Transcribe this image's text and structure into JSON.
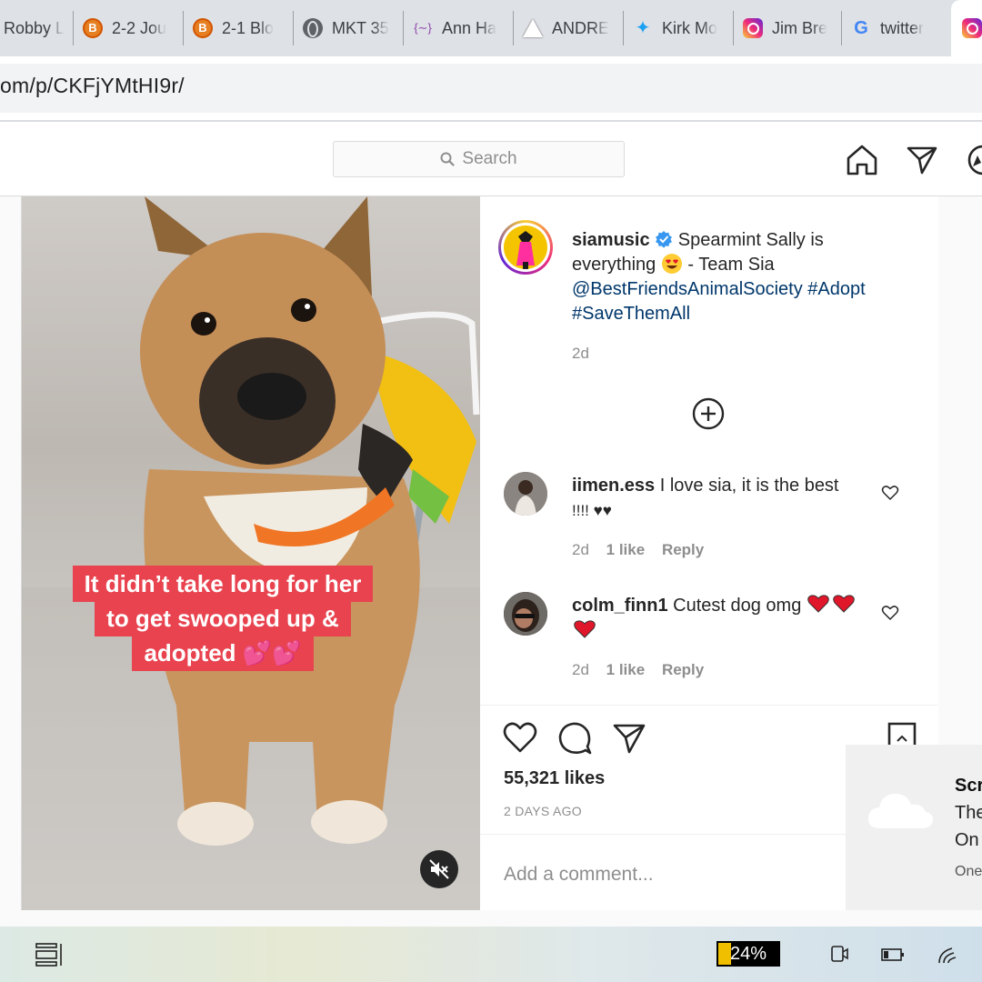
{
  "browser": {
    "tabs": [
      {
        "title": "Robby L",
        "icon": "globe-icon"
      },
      {
        "title": "2-2 Jou",
        "icon": "blogger-icon"
      },
      {
        "title": "2-1 Blo",
        "icon": "blogger-icon"
      },
      {
        "title": "MKT 35",
        "icon": "globe-icon"
      },
      {
        "title": "Ann Ha",
        "icon": "ann-icon"
      },
      {
        "title": "ANDRE",
        "icon": "sail-icon"
      },
      {
        "title": "Kirk Mo",
        "icon": "twitter-icon"
      },
      {
        "title": "Jim Bre",
        "icon": "instagram-icon"
      },
      {
        "title": "twitter",
        "icon": "google-icon"
      }
    ],
    "blogger_letter": "B",
    "google_letter": "G",
    "url": "om/p/CKFjYMtHI9r/"
  },
  "instagram": {
    "search_placeholder": "Search",
    "post": {
      "media_caption_lines": [
        "It didn’t take long for her",
        "to get swooped up &",
        "adopted 💕💕"
      ],
      "author": "siamusic",
      "caption_line1": "Spearmint Sally is",
      "caption_line2a": "everything",
      "caption_line2b": "- Team Sia",
      "mention": "@BestFriendsAnimalSociety",
      "hashtag1": "#Adopt",
      "hashtag2": "#SaveThemAll",
      "time": "2d",
      "comments": [
        {
          "user": "iimen.ess",
          "text_line1": "I love sia, it is the best",
          "text_line2": "!!!! ♥♥",
          "time": "2d",
          "likes": "1 like",
          "reply": "Reply"
        },
        {
          "user": "colm_finn1",
          "text_line1": "Cutest dog omg",
          "text_line2": "",
          "time": "2d",
          "likes": "1 like",
          "reply": "Reply"
        }
      ],
      "likes": "55,321 likes",
      "posted": "2 DAYS AGO",
      "add_comment_placeholder": "Add a comment..."
    }
  },
  "toast": {
    "title": "Scr",
    "line1": "The",
    "line2": "On",
    "footer": "One"
  },
  "taskbar": {
    "battery": "24%"
  },
  "colors": {
    "verified": "#3897f0",
    "link": "#00376b",
    "caption_bg": "#e8434f",
    "heart_red": "#e0162b"
  }
}
